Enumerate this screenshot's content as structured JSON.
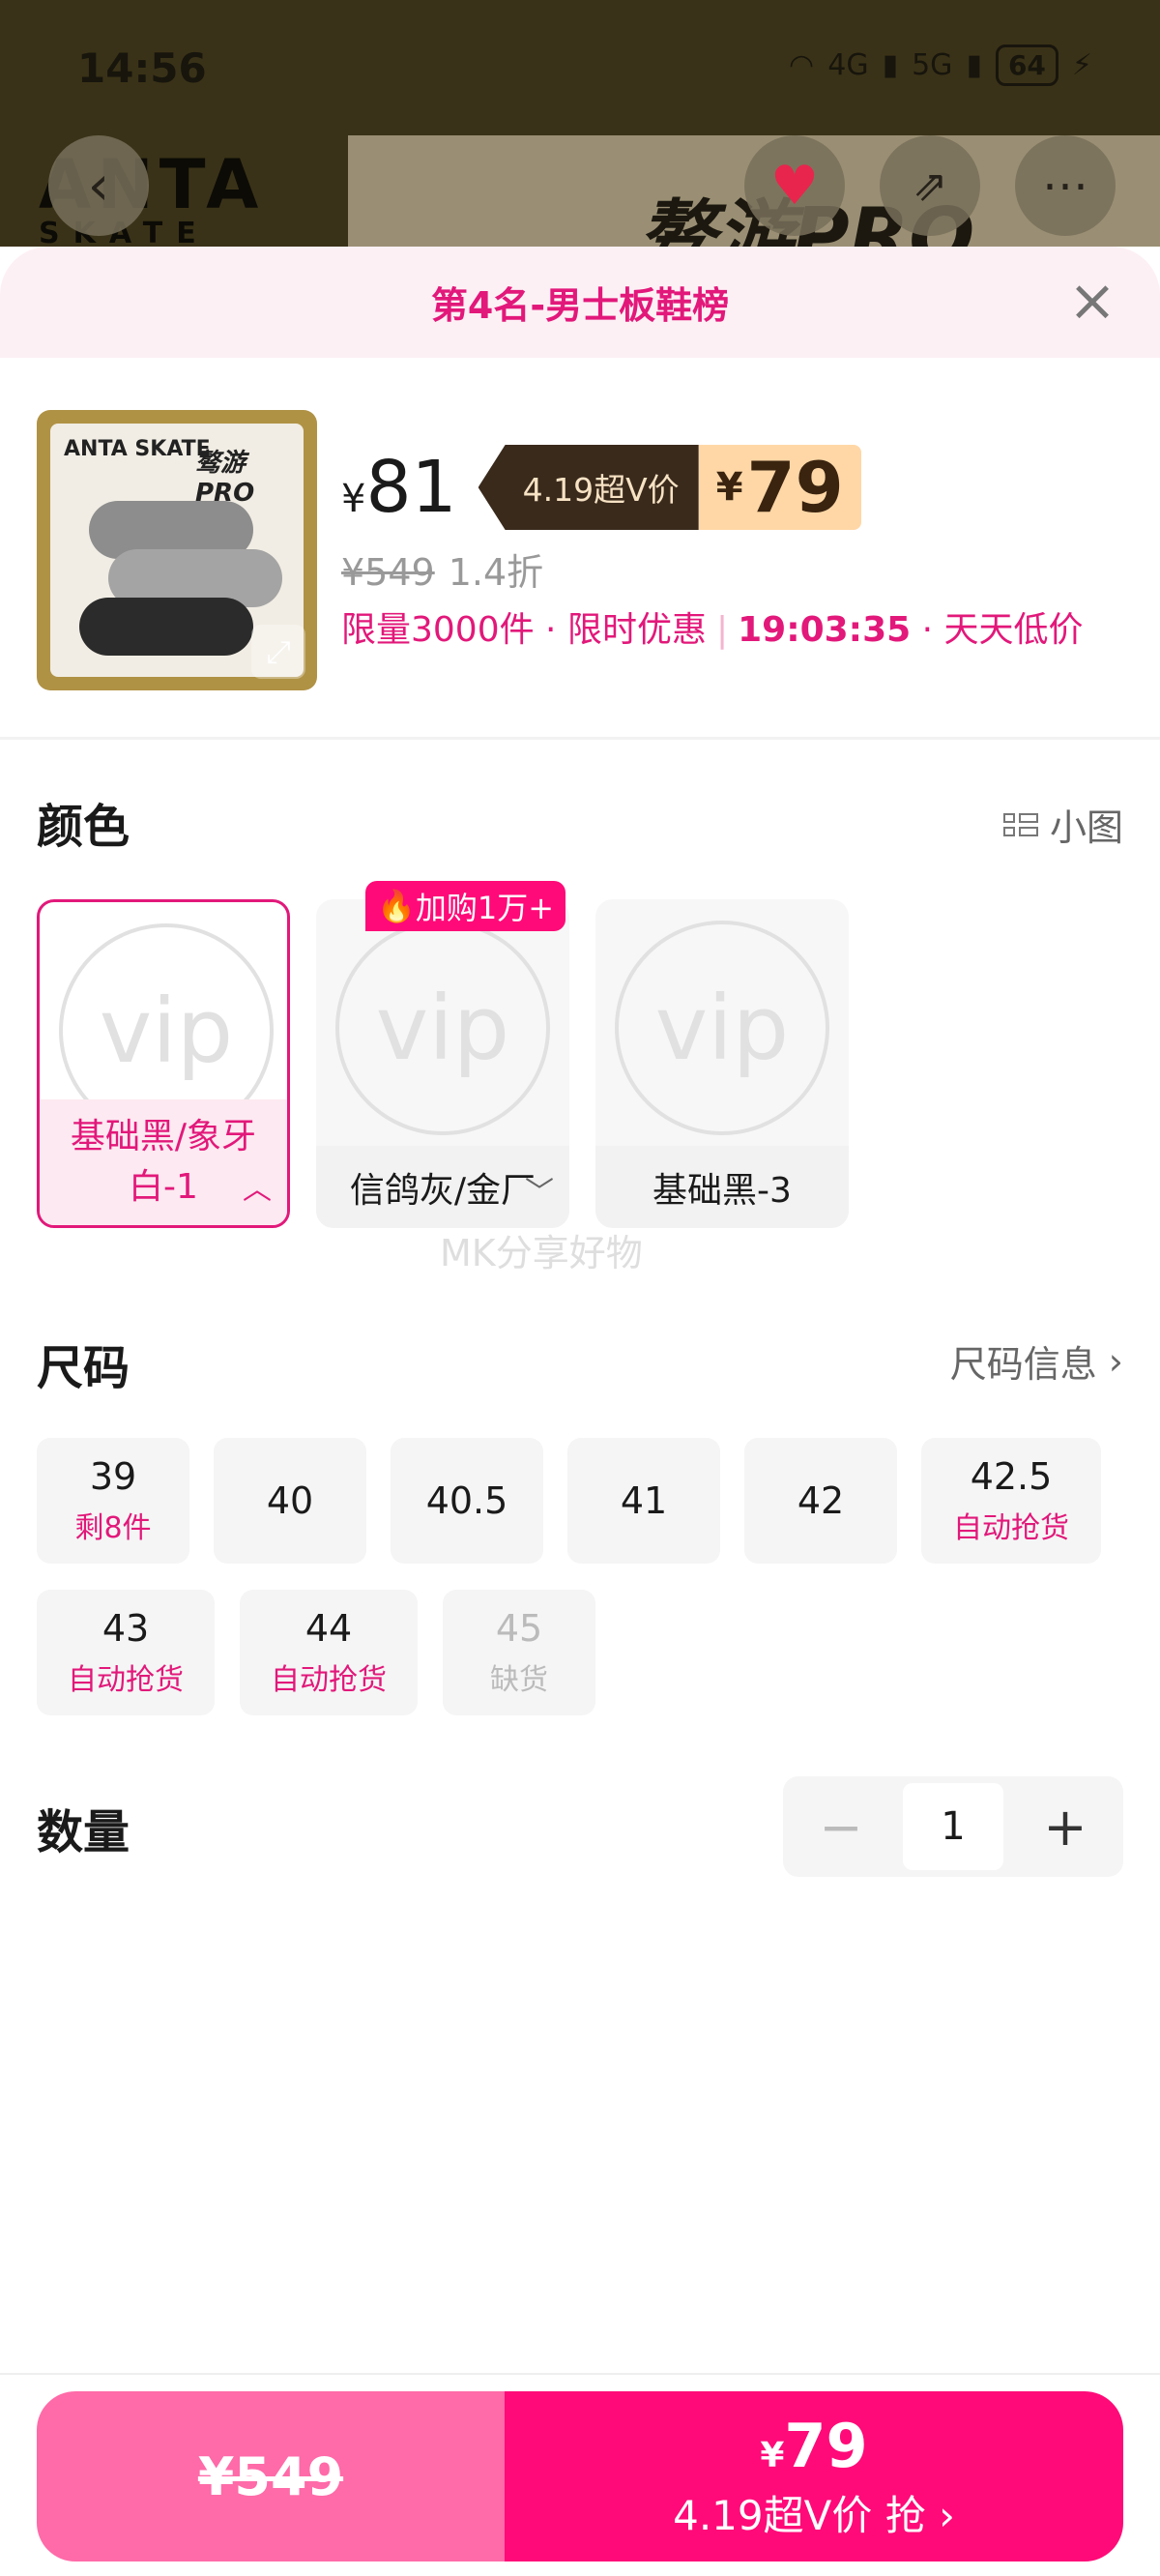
{
  "status": {
    "time": "14:56",
    "net1": "4G",
    "net2": "5G",
    "battery": "64"
  },
  "bg": {
    "brand": "ANTA",
    "brand_sub": "SKATE",
    "banner_text": "骜游PRO"
  },
  "sheet": {
    "title": "第4名-男士板鞋榜"
  },
  "product": {
    "price_symbol": "¥",
    "price": "81",
    "vtag_label": "4.19超V价",
    "vtag_symbol": "¥",
    "vtag_price": "79",
    "orig_price": "¥549",
    "discount": "1.4折",
    "promo1": "限量3000件 · 限时优惠",
    "promo_time": "19:03:35",
    "promo2": " · 天天低价",
    "thumb_logo": "ANTA SKATE",
    "thumb_pro": "骜游PRO"
  },
  "color": {
    "title": "颜色",
    "view_toggle": "小图",
    "badge": "加购1万+",
    "items": [
      {
        "label": "基础黑/象牙白-1",
        "vip": "vip"
      },
      {
        "label": "信鸽灰/金厂",
        "vip": "vip"
      },
      {
        "label": "基础黑-3",
        "vip": "vip"
      }
    ]
  },
  "watermark": "MK分享好物",
  "size": {
    "title": "尺码",
    "info_link": "尺码信息",
    "items": [
      {
        "size": "39",
        "note": "剩8件"
      },
      {
        "size": "40",
        "note": ""
      },
      {
        "size": "40.5",
        "note": ""
      },
      {
        "size": "41",
        "note": ""
      },
      {
        "size": "42",
        "note": ""
      },
      {
        "size": "42.5",
        "note": "自动抢货"
      },
      {
        "size": "43",
        "note": "自动抢货"
      },
      {
        "size": "44",
        "note": "自动抢货"
      },
      {
        "size": "45",
        "note": "缺货"
      }
    ]
  },
  "quantity": {
    "title": "数量",
    "value": "1"
  },
  "buy": {
    "left_price": "¥549",
    "right_symbol": "¥",
    "right_price": "79",
    "right_label": "4.19超V价 抢"
  },
  "colors": {
    "accent": "#e2187a",
    "buy_right": "#ff0a78",
    "buy_left": "#ff6aa8"
  }
}
